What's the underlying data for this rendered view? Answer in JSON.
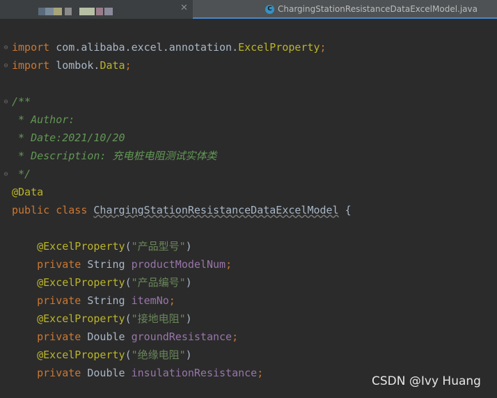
{
  "tabs": [
    {
      "label": "",
      "active": false
    },
    {
      "label": "ChargingStationResistanceDataExcelModel.java",
      "icon": "class-icon",
      "active": true
    }
  ],
  "code": {
    "l1": {
      "kw": "import",
      "pkg": " com.alibaba.excel.annotation.",
      "cls": "ExcelProperty",
      "semi": ";"
    },
    "l2": {
      "kw": "import",
      "pkg": " lombok.",
      "cls": "Data",
      "semi": ";"
    },
    "l4": "/**",
    "l5": {
      "tag": " * Author:",
      "text": ""
    },
    "l6": {
      "tag": " * Date:",
      "text": "2021/10/20"
    },
    "l7": {
      "tag": " * Description:",
      "text": " 充电桩电阻测试实体类"
    },
    "l8": " */",
    "l9": "@Data",
    "l10": {
      "kw": "public class",
      "cls": "ChargingStationResistanceDataExcelModel",
      "brace": " {"
    },
    "fields": [
      {
        "ann": "@ExcelProperty",
        "arg": "\"产品型号\"",
        "mod": "private",
        "type": " String ",
        "name": "productModelNum"
      },
      {
        "ann": "@ExcelProperty",
        "arg": "\"产品编号\"",
        "mod": "private",
        "type": " String ",
        "name": "itemNo"
      },
      {
        "ann": "@ExcelProperty",
        "arg": "\"接地电阻\"",
        "mod": "private",
        "type": " Double ",
        "name": "groundResistance"
      },
      {
        "ann": "@ExcelProperty",
        "arg": "\"绝缘电阻\"",
        "mod": "private",
        "type": " Double ",
        "name": "insulationResistance"
      }
    ]
  },
  "watermark": "CSDN @Ivy Huang",
  "colors": {
    "keyword": "#cc7832",
    "annotation": "#bbb529",
    "string": "#6a8759",
    "field": "#9876aa",
    "doc": "#629755",
    "text": "#a9b7c6",
    "background": "#2b2b2b"
  }
}
